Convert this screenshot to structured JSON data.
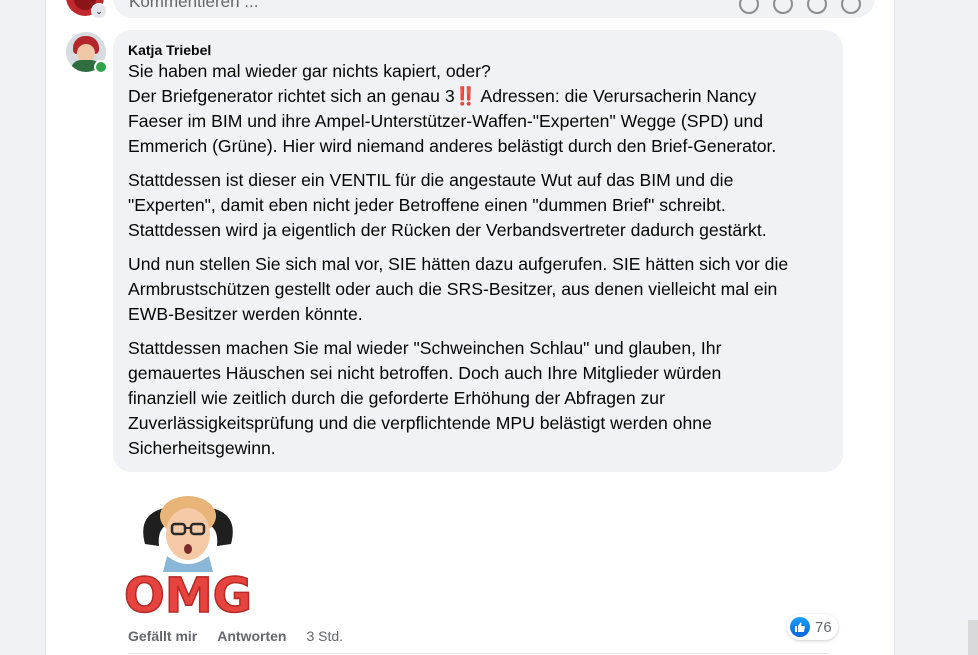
{
  "composer": {
    "placeholder": "Kommentieren ...",
    "icons": [
      "avatar-sticker-icon",
      "emoji-icon",
      "gif-icon",
      "sticker-icon"
    ]
  },
  "comment": {
    "author": "Katja Triebel",
    "paragraphs": [
      [
        "Sie haben mal wieder gar nichts kapiert, oder?",
        "Der Briefgenerator richtet sich an genau 3",
        "‼️",
        " Adressen: die Verursacherin Nancy",
        "Faeser im BIM und ihre Ampel-Unterstützer-Waffen-\"Experten\" Wegge (SPD) und",
        "Emmerich (Grüne). Hier wird niemand anderes belästigt durch den Brief-Generator."
      ],
      [
        "Stattdessen ist dieser ein VENTIL für die angestaute Wut auf das BIM und die",
        "\"Experten\", damit eben nicht jeder Betroffene einen \"dummen Brief\" schreibt.",
        "Stattdessen wird ja eigentlich der Rücken der Verbandsvertreter dadurch gestärkt."
      ],
      [
        "Und nun stellen Sie sich mal vor, SIE hätten dazu aufgerufen. SIE hätten sich vor die",
        "Armbrustschützen gestellt oder auch die SRS-Besitzer, aus denen vielleicht mal ein",
        "EWB-Besitzer werden könnte."
      ],
      [
        "Stattdessen machen Sie mal wieder \"Schweinchen Schlau\" und glauben, Ihr",
        "gemauertes Häuschen sei nicht betroffen. Doch auch Ihre Mitglieder würden",
        "finanziell wie zeitlich durch die geforderte Erhöhung der Abfragen zur",
        "Zuverlässigkeitsprüfung und die verpflichtende MPU belästigt werden ohne",
        "Sicherheitsgewinn."
      ]
    ],
    "sticker_text": "OMG",
    "actions": {
      "like": "Gefällt mir",
      "reply": "Antworten",
      "time": "3 Std."
    },
    "reactions": {
      "icon": "like-icon",
      "count": "76"
    }
  },
  "colors": {
    "like_blue": "#0a64d8",
    "online_green": "#31a24c",
    "sticker_red": "#e8443f"
  }
}
